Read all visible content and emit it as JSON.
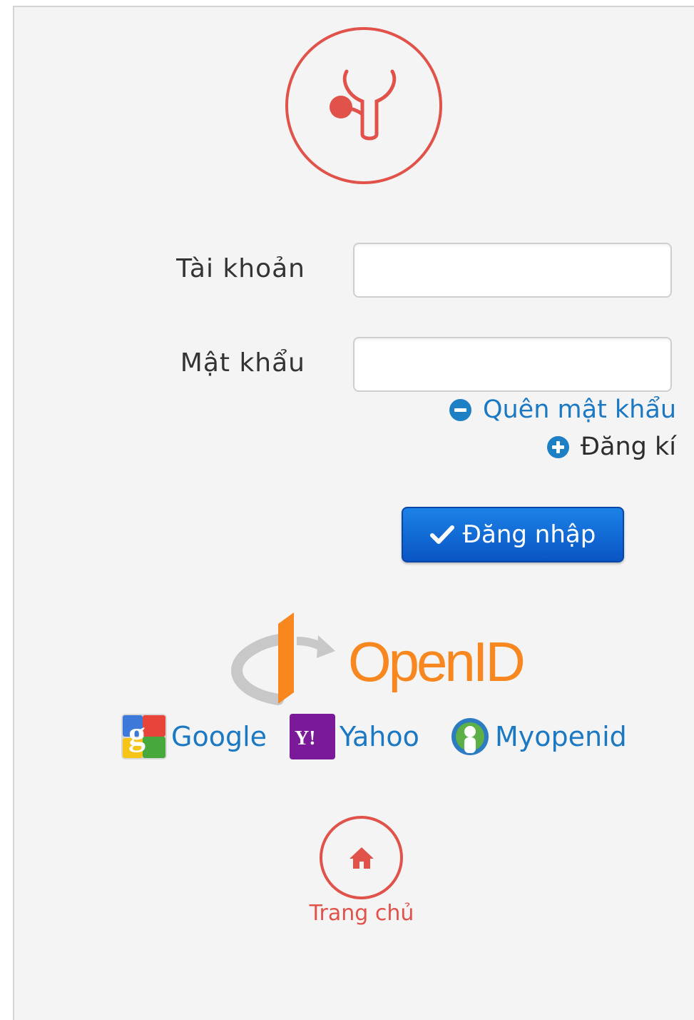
{
  "form": {
    "username_label": "Tài khoản",
    "username_value": "",
    "password_label": "Mật khẩu",
    "password_value": ""
  },
  "links": {
    "forgot_password": "Quên mật khẩu",
    "register": "Đăng kí"
  },
  "login_button": {
    "label": "Đăng nhập"
  },
  "openid": {
    "logo_text": "OpenID",
    "providers": [
      {
        "name": "Google",
        "icon": "google-icon"
      },
      {
        "name": "Yahoo",
        "icon": "yahoo-icon",
        "icon_text": "Y!"
      },
      {
        "name": "Myopenid",
        "icon": "myopenid-icon"
      }
    ]
  },
  "home": {
    "label": "Trang chủ",
    "icon": "home-icon"
  },
  "colors": {
    "accent_red": "#e0524a",
    "link_blue": "#1b78c2",
    "button_blue": "#0a55c4",
    "openid_orange": "#f7871e",
    "panel_bg": "#f4f4f4"
  }
}
